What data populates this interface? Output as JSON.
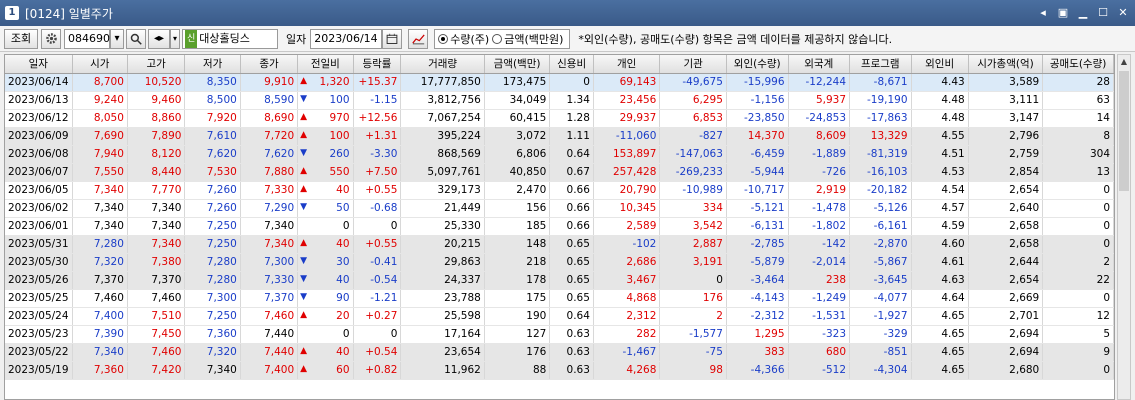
{
  "window": {
    "number": "1",
    "title": "[0124] 일별주가"
  },
  "toolbar": {
    "query_button": "조회",
    "code": "084690",
    "stock_name": "대상홀딩스",
    "stock_badge": "신",
    "date_label": "일자",
    "date": "2023/06/14",
    "radio_qty": "수량(주)",
    "radio_amt": "금액(백만원)",
    "notice": "*외인(수량), 공매도(수량) 항목은 금액 데이터를 제공하지 않습니다."
  },
  "colors": {
    "up": "#e00000",
    "down": "#1a3dc8"
  },
  "icons": {
    "settings": "gear-icon",
    "search": "search-icon",
    "calendar": "calendar-icon",
    "chart": "chart-icon",
    "speaker": "speaker-icon"
  },
  "columns": [
    "일자",
    "시가",
    "고가",
    "저가",
    "종가",
    "전일비",
    "등락률",
    "거래량",
    "금액(백만)",
    "신용비",
    "개인",
    "기관",
    "외인(수량)",
    "외국계",
    "프로그램",
    "외인비",
    "시가총액(억)",
    "공매도(수량)"
  ],
  "rows": [
    {
      "date": "2023/06/14",
      "open": "8,700",
      "high": "10,520",
      "low": "8,350",
      "close": "9,910",
      "dir": "up",
      "change": "1,320",
      "rate": "+15.37",
      "volume": "17,777,850",
      "amount": "173,475",
      "credit": "0",
      "indiv": "69,143",
      "inst": "-49,675",
      "foreign": "-15,996",
      "fcomp": "-12,244",
      "program": "-8,671",
      "fratio": "4.43",
      "mcap": "3,589",
      "short": "28",
      "oc": "r",
      "hc": "r",
      "lc": "b",
      "cc": "r"
    },
    {
      "date": "2023/06/13",
      "open": "9,240",
      "high": "9,460",
      "low": "8,500",
      "close": "8,590",
      "dir": "down",
      "change": "100",
      "rate": "-1.15",
      "volume": "3,812,756",
      "amount": "34,049",
      "credit": "1.34",
      "indiv": "23,456",
      "inst": "6,295",
      "foreign": "-1,156",
      "fcomp": "5,937",
      "program": "-19,190",
      "fratio": "4.48",
      "mcap": "3,111",
      "short": "63",
      "oc": "r",
      "hc": "r",
      "lc": "b",
      "cc": "b"
    },
    {
      "date": "2023/06/12",
      "open": "8,050",
      "high": "8,860",
      "low": "7,920",
      "close": "8,690",
      "dir": "up",
      "change": "970",
      "rate": "+12.56",
      "volume": "7,067,254",
      "amount": "60,415",
      "credit": "1.28",
      "indiv": "29,937",
      "inst": "6,853",
      "foreign": "-23,850",
      "fcomp": "-24,853",
      "program": "-17,863",
      "fratio": "4.48",
      "mcap": "3,147",
      "short": "14",
      "oc": "r",
      "hc": "r",
      "lc": "r",
      "cc": "r"
    },
    {
      "date": "2023/06/09",
      "open": "7,690",
      "high": "7,890",
      "low": "7,610",
      "close": "7,720",
      "dir": "up",
      "change": "100",
      "rate": "+1.31",
      "volume": "395,224",
      "amount": "3,072",
      "credit": "1.11",
      "indiv": "-11,060",
      "inst": "-827",
      "foreign": "14,370",
      "fcomp": "8,609",
      "program": "13,329",
      "fratio": "4.55",
      "mcap": "2,796",
      "short": "8",
      "oc": "r",
      "hc": "r",
      "lc": "b",
      "cc": "r"
    },
    {
      "date": "2023/06/08",
      "open": "7,940",
      "high": "8,120",
      "low": "7,620",
      "close": "7,620",
      "dir": "down",
      "change": "260",
      "rate": "-3.30",
      "volume": "868,569",
      "amount": "6,806",
      "credit": "0.64",
      "indiv": "153,897",
      "inst": "-147,063",
      "foreign": "-6,459",
      "fcomp": "-1,889",
      "program": "-81,319",
      "fratio": "4.51",
      "mcap": "2,759",
      "short": "304",
      "oc": "r",
      "hc": "r",
      "lc": "b",
      "cc": "b"
    },
    {
      "date": "2023/06/07",
      "open": "7,550",
      "high": "8,440",
      "low": "7,530",
      "close": "7,880",
      "dir": "up",
      "change": "550",
      "rate": "+7.50",
      "volume": "5,097,761",
      "amount": "40,850",
      "credit": "0.67",
      "indiv": "257,428",
      "inst": "-269,233",
      "foreign": "-5,944",
      "fcomp": "-726",
      "program": "-16,103",
      "fratio": "4.53",
      "mcap": "2,854",
      "short": "13",
      "oc": "r",
      "hc": "r",
      "lc": "r",
      "cc": "r"
    },
    {
      "date": "2023/06/05",
      "open": "7,340",
      "high": "7,770",
      "low": "7,260",
      "close": "7,330",
      "dir": "up",
      "change": "40",
      "rate": "+0.55",
      "volume": "329,173",
      "amount": "2,470",
      "credit": "0.66",
      "indiv": "20,790",
      "inst": "-10,989",
      "foreign": "-10,717",
      "fcomp": "2,919",
      "program": "-20,182",
      "fratio": "4.54",
      "mcap": "2,654",
      "short": "0",
      "oc": "r",
      "hc": "r",
      "lc": "b",
      "cc": "r"
    },
    {
      "date": "2023/06/02",
      "open": "7,340",
      "high": "7,340",
      "low": "7,260",
      "close": "7,290",
      "dir": "down",
      "change": "50",
      "rate": "-0.68",
      "volume": "21,449",
      "amount": "156",
      "credit": "0.66",
      "indiv": "10,345",
      "inst": "334",
      "foreign": "-5,121",
      "fcomp": "-1,478",
      "program": "-5,126",
      "fratio": "4.57",
      "mcap": "2,640",
      "short": "0",
      "oc": "k",
      "hc": "k",
      "lc": "b",
      "cc": "b"
    },
    {
      "date": "2023/06/01",
      "open": "7,340",
      "high": "7,340",
      "low": "7,250",
      "close": "7,340",
      "dir": "none",
      "change": "0",
      "rate": "0",
      "volume": "25,330",
      "amount": "185",
      "credit": "0.66",
      "indiv": "2,589",
      "inst": "3,542",
      "foreign": "-6,131",
      "fcomp": "-1,802",
      "program": "-6,161",
      "fratio": "4.59",
      "mcap": "2,658",
      "short": "0",
      "oc": "k",
      "hc": "k",
      "lc": "b",
      "cc": "k"
    },
    {
      "date": "2023/05/31",
      "open": "7,280",
      "high": "7,340",
      "low": "7,250",
      "close": "7,340",
      "dir": "up",
      "change": "40",
      "rate": "+0.55",
      "volume": "20,215",
      "amount": "148",
      "credit": "0.65",
      "indiv": "-102",
      "inst": "2,887",
      "foreign": "-2,785",
      "fcomp": "-142",
      "program": "-2,870",
      "fratio": "4.60",
      "mcap": "2,658",
      "short": "0",
      "oc": "b",
      "hc": "r",
      "lc": "b",
      "cc": "r"
    },
    {
      "date": "2023/05/30",
      "open": "7,320",
      "high": "7,380",
      "low": "7,280",
      "close": "7,300",
      "dir": "down",
      "change": "30",
      "rate": "-0.41",
      "volume": "29,863",
      "amount": "218",
      "credit": "0.65",
      "indiv": "2,686",
      "inst": "3,191",
      "foreign": "-5,879",
      "fcomp": "-2,014",
      "program": "-5,867",
      "fratio": "4.61",
      "mcap": "2,644",
      "short": "2",
      "oc": "b",
      "hc": "r",
      "lc": "b",
      "cc": "b"
    },
    {
      "date": "2023/05/26",
      "open": "7,370",
      "high": "7,370",
      "low": "7,280",
      "close": "7,330",
      "dir": "down",
      "change": "40",
      "rate": "-0.54",
      "volume": "24,337",
      "amount": "178",
      "credit": "0.65",
      "indiv": "3,467",
      "inst": "0",
      "foreign": "-3,464",
      "fcomp": "238",
      "program": "-3,645",
      "fratio": "4.63",
      "mcap": "2,654",
      "short": "22",
      "oc": "k",
      "hc": "k",
      "lc": "b",
      "cc": "b"
    },
    {
      "date": "2023/05/25",
      "open": "7,460",
      "high": "7,460",
      "low": "7,300",
      "close": "7,370",
      "dir": "down",
      "change": "90",
      "rate": "-1.21",
      "volume": "23,788",
      "amount": "175",
      "credit": "0.65",
      "indiv": "4,868",
      "inst": "176",
      "foreign": "-4,143",
      "fcomp": "-1,249",
      "program": "-4,077",
      "fratio": "4.64",
      "mcap": "2,669",
      "short": "0",
      "oc": "k",
      "hc": "k",
      "lc": "b",
      "cc": "b"
    },
    {
      "date": "2023/05/24",
      "open": "7,400",
      "high": "7,510",
      "low": "7,250",
      "close": "7,460",
      "dir": "up",
      "change": "20",
      "rate": "+0.27",
      "volume": "25,598",
      "amount": "190",
      "credit": "0.64",
      "indiv": "2,312",
      "inst": "2",
      "foreign": "-2,312",
      "fcomp": "-1,531",
      "program": "-1,927",
      "fratio": "4.65",
      "mcap": "2,701",
      "short": "12",
      "oc": "b",
      "hc": "r",
      "lc": "b",
      "cc": "r"
    },
    {
      "date": "2023/05/23",
      "open": "7,390",
      "high": "7,450",
      "low": "7,360",
      "close": "7,440",
      "dir": "none",
      "change": "0",
      "rate": "0",
      "volume": "17,164",
      "amount": "127",
      "credit": "0.63",
      "indiv": "282",
      "inst": "-1,577",
      "foreign": "1,295",
      "fcomp": "-323",
      "program": "-329",
      "fratio": "4.65",
      "mcap": "2,694",
      "short": "5",
      "oc": "b",
      "hc": "r",
      "lc": "b",
      "cc": "k"
    },
    {
      "date": "2023/05/22",
      "open": "7,340",
      "high": "7,460",
      "low": "7,320",
      "close": "7,440",
      "dir": "up",
      "change": "40",
      "rate": "+0.54",
      "volume": "23,654",
      "amount": "176",
      "credit": "0.63",
      "indiv": "-1,467",
      "inst": "-75",
      "foreign": "383",
      "fcomp": "680",
      "program": "-851",
      "fratio": "4.65",
      "mcap": "2,694",
      "short": "9",
      "oc": "b",
      "hc": "r",
      "lc": "b",
      "cc": "r"
    },
    {
      "date": "2023/05/19",
      "open": "7,360",
      "high": "7,420",
      "low": "7,340",
      "close": "7,400",
      "dir": "up",
      "change": "60",
      "rate": "+0.82",
      "volume": "11,962",
      "amount": "88",
      "credit": "0.63",
      "indiv": "4,268",
      "inst": "98",
      "foreign": "-4,366",
      "fcomp": "-512",
      "program": "-4,304",
      "fratio": "4.65",
      "mcap": "2,680",
      "short": "0",
      "oc": "r",
      "hc": "r",
      "lc": "k",
      "cc": "r"
    }
  ]
}
